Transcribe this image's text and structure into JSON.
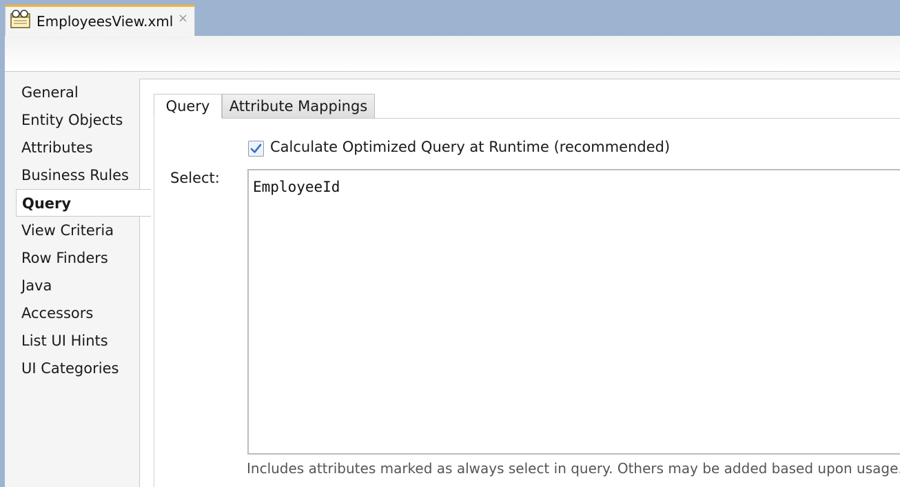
{
  "editor_tab": {
    "title": "EmployeesView.xml",
    "close_glyph": "×",
    "icon": "view-object-file-icon"
  },
  "nav": {
    "items": [
      {
        "label": "General",
        "selected": false
      },
      {
        "label": "Entity Objects",
        "selected": false
      },
      {
        "label": "Attributes",
        "selected": false
      },
      {
        "label": "Business Rules",
        "selected": false
      },
      {
        "label": "Query",
        "selected": true
      },
      {
        "label": "View Criteria",
        "selected": false
      },
      {
        "label": "Row Finders",
        "selected": false
      },
      {
        "label": "Java",
        "selected": false
      },
      {
        "label": "Accessors",
        "selected": false
      },
      {
        "label": "List UI Hints",
        "selected": false
      },
      {
        "label": "UI Categories",
        "selected": false
      }
    ]
  },
  "subtabs": [
    {
      "label": "Query",
      "active": true
    },
    {
      "label": "Attribute Mappings",
      "active": false
    }
  ],
  "query": {
    "optimize_checkbox_label": "Calculate Optimized Query at Runtime (recommended)",
    "optimize_checked": true,
    "select_label": "Select:",
    "select_value": "EmployeeId",
    "hint": "Includes attributes marked as always select in query.  Others may be added based upon usage."
  },
  "colors": {
    "frame_blue": "#9db3cf",
    "tab_accent": "#f5b531",
    "checkmark_blue": "#3b6fc4"
  }
}
